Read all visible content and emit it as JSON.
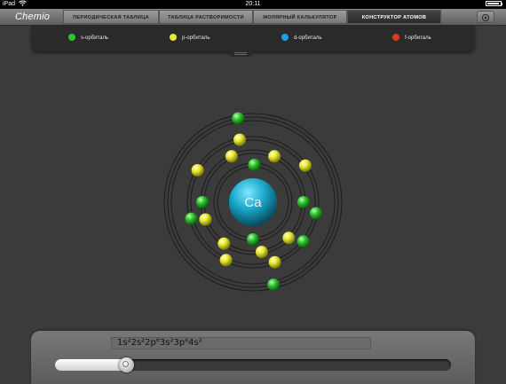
{
  "status_bar": {
    "device": "iPad",
    "wifi_icon": "wifi-icon",
    "time": "20:11",
    "battery_icon": "battery-icon"
  },
  "nav": {
    "app_title": "Chemio",
    "tabs": [
      {
        "label": "ПЕРИОДИЧЕСКАЯ ТАБЛИЦА",
        "active": false
      },
      {
        "label": "ТАБЛИЦА РАСТВОРИМОСТИ",
        "active": false
      },
      {
        "label": "МОЛЯРНЫЙ КАЛЬКУЛЯТОР",
        "active": false
      },
      {
        "label": "КОНСТРУКТОР АТОМОВ",
        "active": true
      }
    ],
    "settings_icon": "gear-icon"
  },
  "legend": {
    "items": [
      {
        "label": "s-орбиталь",
        "color": "#2fc22f"
      },
      {
        "label": "p-орбиталь",
        "color": "#e8e830"
      },
      {
        "label": "d-орбиталь",
        "color": "#1e9ee0"
      },
      {
        "label": "f-орбиталь",
        "color": "#e03a1e"
      }
    ]
  },
  "atom": {
    "symbol": "Ca",
    "nucleus_color": "#1aa7c9",
    "shells": [
      {
        "electrons": [
          {
            "type": "s",
            "angle": -88
          },
          {
            "type": "s",
            "angle": 90
          }
        ]
      },
      {
        "electrons": [
          {
            "type": "p",
            "angle": -115
          },
          {
            "type": "p",
            "angle": -65
          },
          {
            "type": "s",
            "angle": 0
          },
          {
            "type": "p",
            "angle": 45
          },
          {
            "type": "p",
            "angle": 80
          },
          {
            "type": "p",
            "angle": 125
          },
          {
            "type": "p",
            "angle": 160
          },
          {
            "type": "s",
            "angle": 180
          }
        ]
      },
      {
        "electrons": [
          {
            "type": "p",
            "angle": -102
          },
          {
            "type": "p",
            "angle": -150
          },
          {
            "type": "p",
            "angle": -35
          },
          {
            "type": "s",
            "angle": 10
          },
          {
            "type": "s",
            "angle": 38
          },
          {
            "type": "p",
            "angle": 70
          },
          {
            "type": "p",
            "angle": 115
          },
          {
            "type": "s",
            "angle": 165
          }
        ]
      },
      {
        "electrons": [
          {
            "type": "s",
            "angle": -100
          },
          {
            "type": "s",
            "angle": 76
          }
        ]
      }
    ]
  },
  "configuration": {
    "text": "1s²2s²2p⁶3s²3p⁶4s²",
    "slider_level": 0.18
  }
}
